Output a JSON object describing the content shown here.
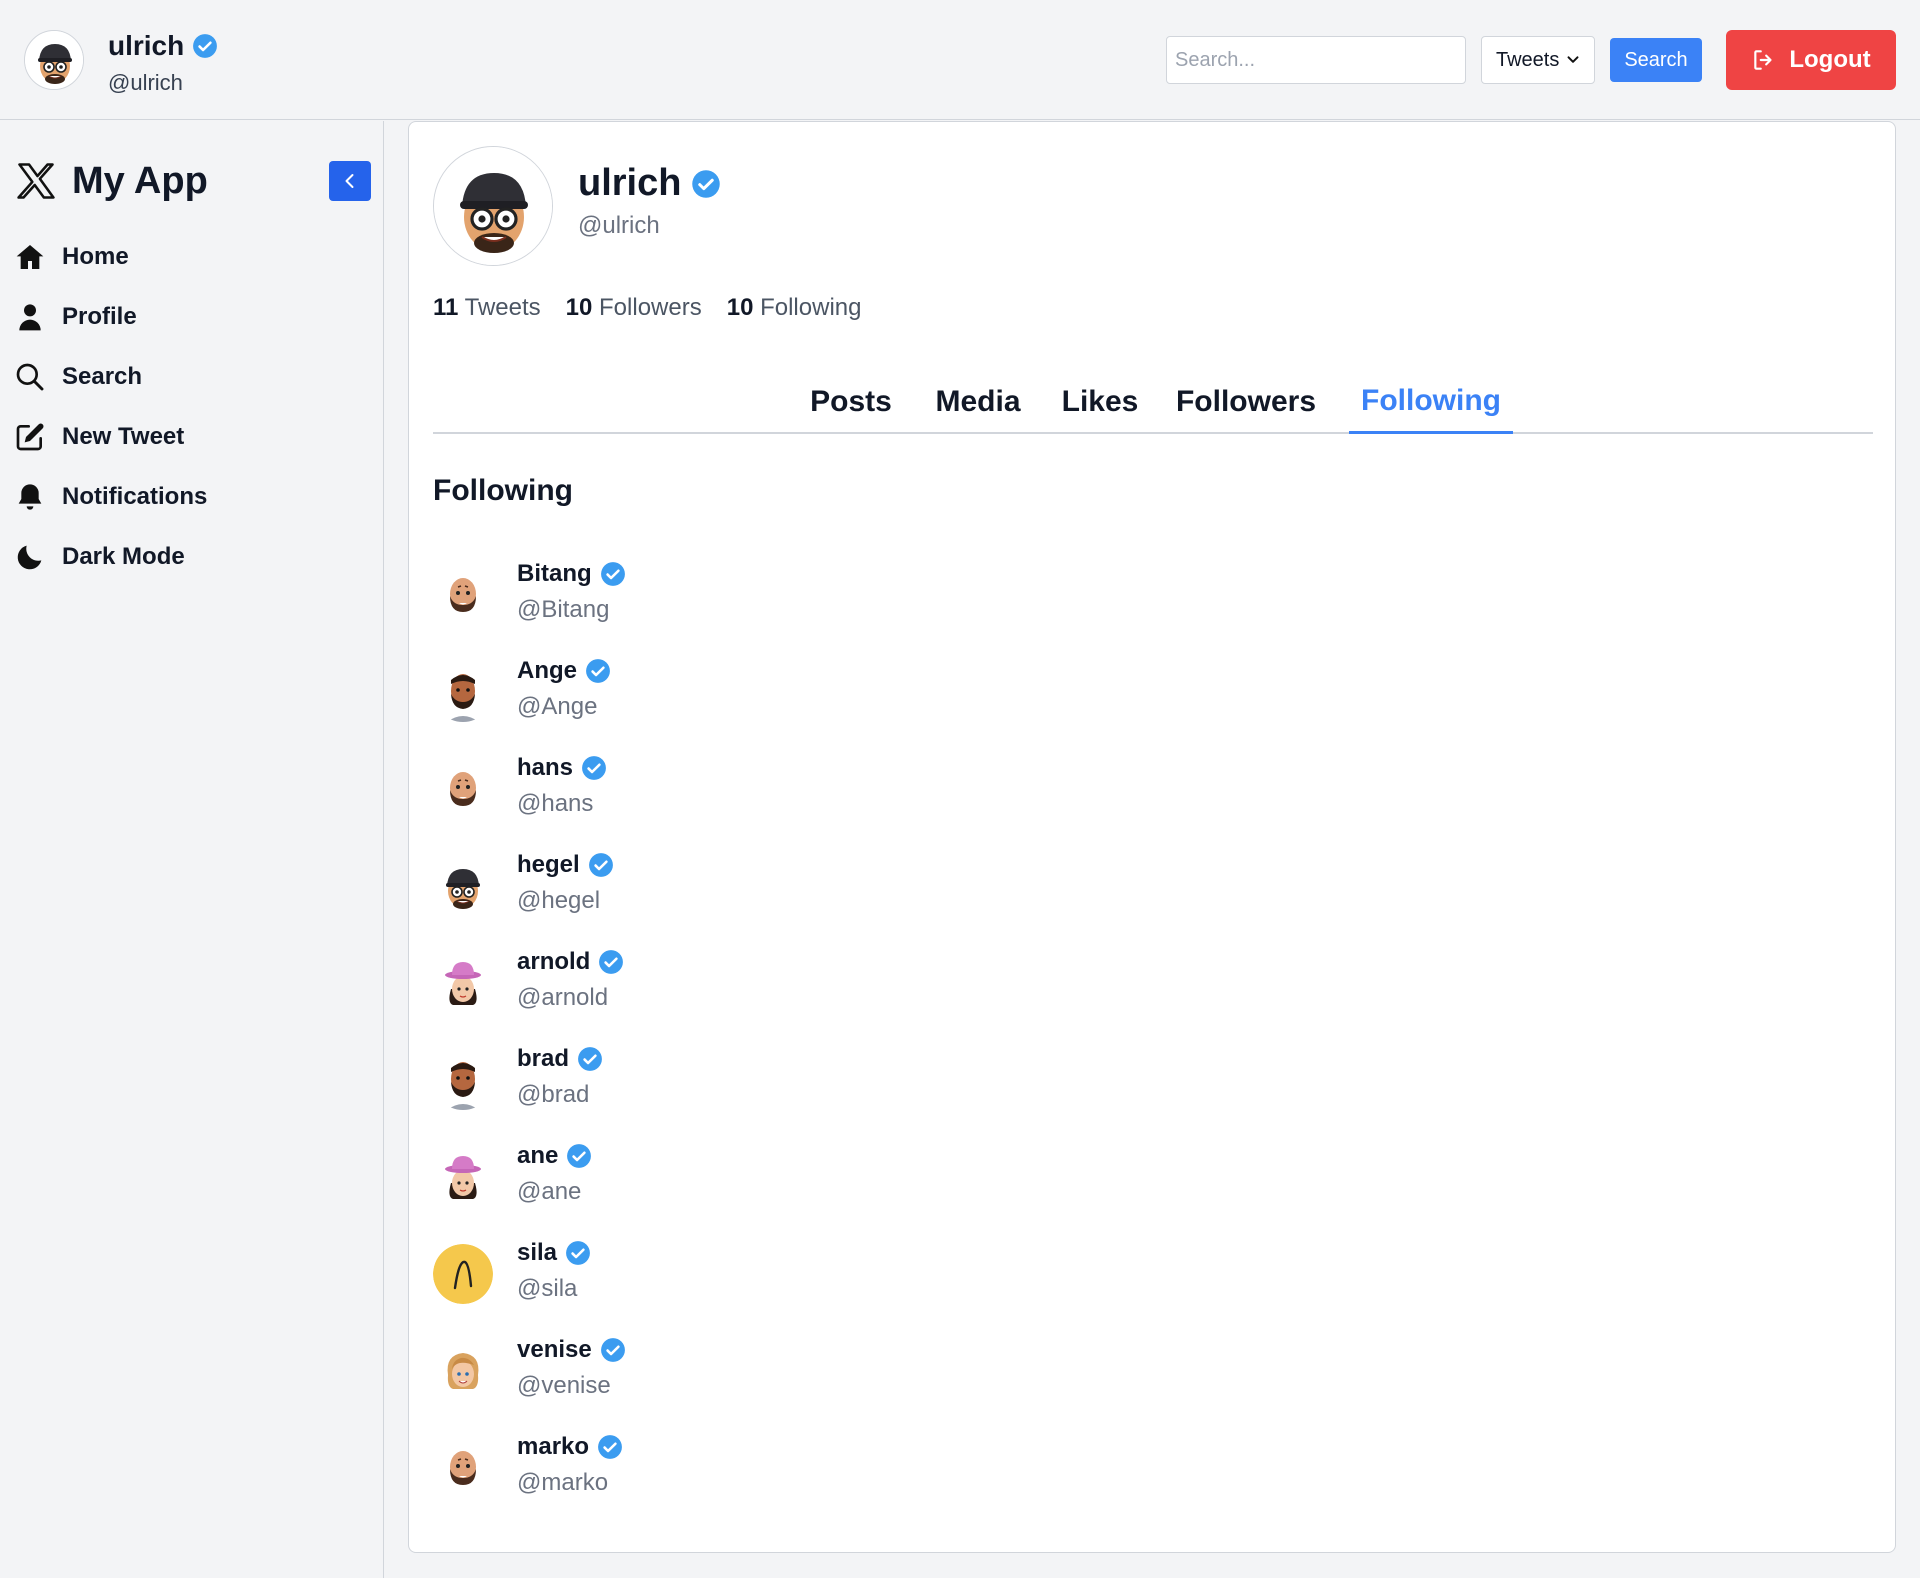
{
  "header": {
    "user_name": "ulrich",
    "user_handle": "@ulrich",
    "search_placeholder": "Search...",
    "search_type": "Tweets",
    "search_label": "Search",
    "logout_label": "Logout"
  },
  "sidebar": {
    "brand": "My App",
    "items": [
      {
        "label": "Home",
        "icon": "home-icon"
      },
      {
        "label": "Profile",
        "icon": "user-icon"
      },
      {
        "label": "Search",
        "icon": "search-icon"
      },
      {
        "label": "New Tweet",
        "icon": "edit-icon"
      },
      {
        "label": "Notifications",
        "icon": "bell-icon"
      },
      {
        "label": "Dark Mode",
        "icon": "moon-icon"
      }
    ]
  },
  "profile": {
    "name": "ulrich",
    "handle": "@ulrich",
    "stats": {
      "tweets_count": "11",
      "tweets_label": "Tweets",
      "followers_count": "10",
      "followers_label": "Followers",
      "following_count": "10",
      "following_label": "Following"
    },
    "tabs": [
      "Posts",
      "Media",
      "Likes",
      "Followers",
      "Following"
    ],
    "active_tab": "Following",
    "section_title": "Following"
  },
  "following": [
    {
      "name": "Bitang",
      "handle": "@Bitang",
      "avatar": "bald-bearded"
    },
    {
      "name": "Ange",
      "handle": "@Ange",
      "avatar": "dark-bearded"
    },
    {
      "name": "hans",
      "handle": "@hans",
      "avatar": "bald-bearded"
    },
    {
      "name": "hegel",
      "handle": "@hegel",
      "avatar": "cap-glasses"
    },
    {
      "name": "arnold",
      "handle": "@arnold",
      "avatar": "pink-hat"
    },
    {
      "name": "brad",
      "handle": "@brad",
      "avatar": "dark-bearded"
    },
    {
      "name": "ane",
      "handle": "@ane",
      "avatar": "pink-hat"
    },
    {
      "name": "sila",
      "handle": "@sila",
      "avatar": "yellow-logo"
    },
    {
      "name": "venise",
      "handle": "@venise",
      "avatar": "blonde"
    },
    {
      "name": "marko",
      "handle": "@marko",
      "avatar": "bald-bearded"
    }
  ],
  "colors": {
    "accent": "#3b82f6",
    "logout": "#ef4444",
    "collapse": "#2563eb",
    "verified": "#3b9cf0"
  }
}
